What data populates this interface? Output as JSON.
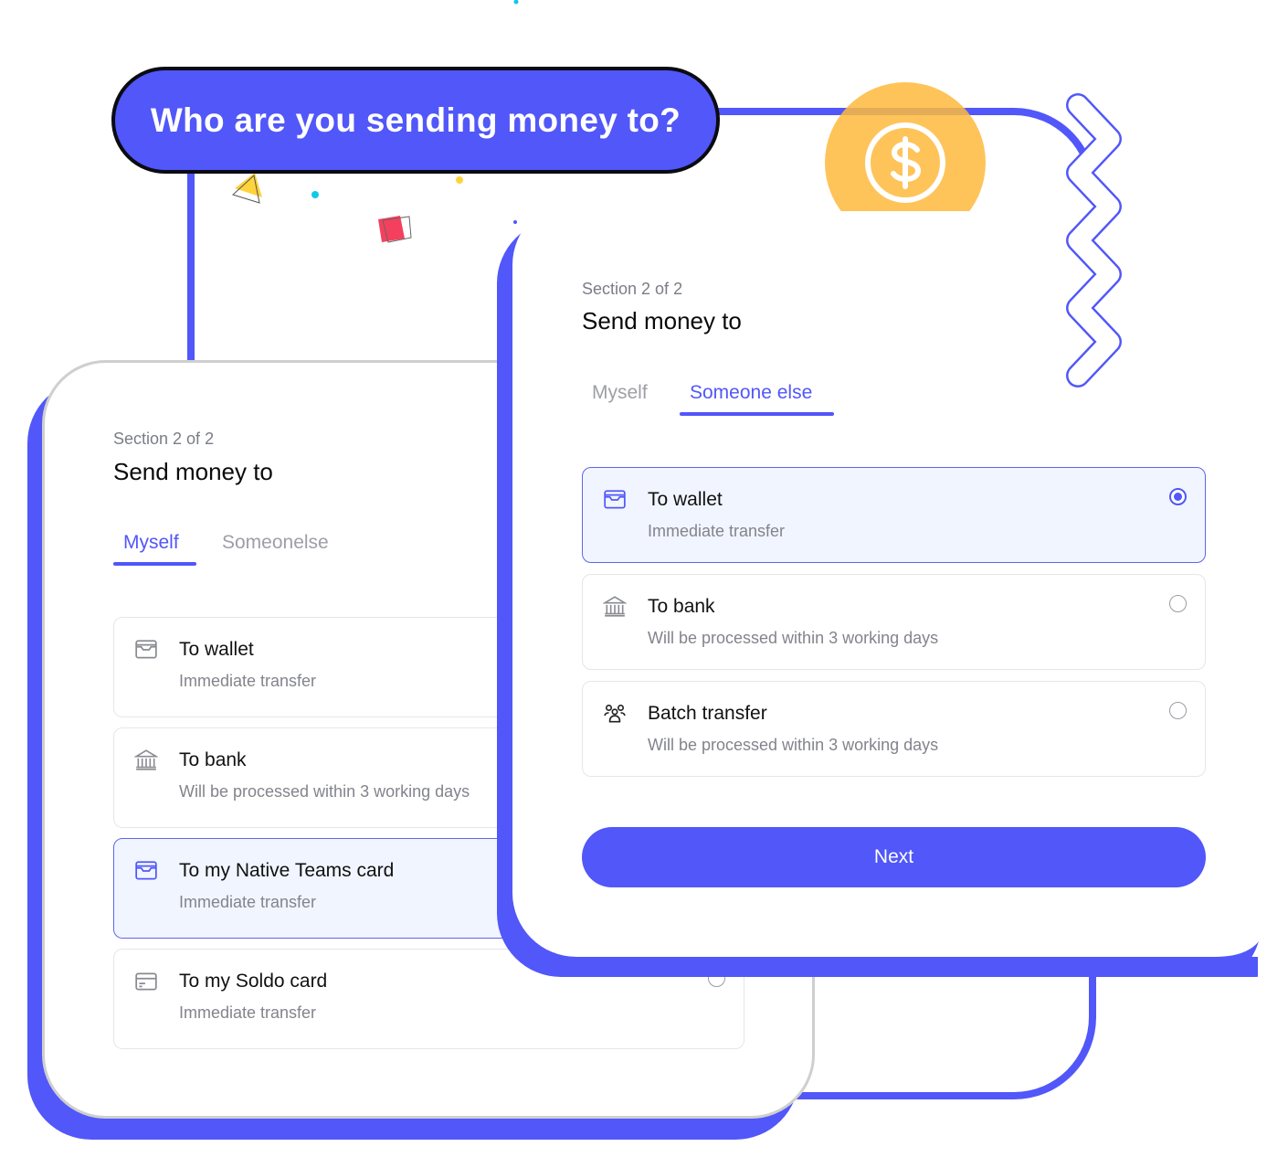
{
  "headline": "Who are you sending money to?",
  "colors": {
    "accent": "#5157f9",
    "coin": "#febb3c",
    "selected_bg": "#f1f5ff",
    "muted_text": "#83848c"
  },
  "decor": {
    "coin_icon": "dollar-coin-icon",
    "zigzag": "zigzag-decoration",
    "confetti": [
      "triangle-yellow",
      "dot-cyan",
      "dot-yellow",
      "square-red",
      "dot-blue",
      "dot-cyan-top"
    ]
  },
  "back_card": {
    "section_label": "Section 2 of 2",
    "title": "Send money to",
    "tabs": [
      {
        "label": "Myself",
        "active": true
      },
      {
        "label": "Someonelse",
        "active": false
      }
    ],
    "options": [
      {
        "icon": "wallet-icon",
        "title": "To wallet",
        "subtitle": "Immediate transfer",
        "selected": false
      },
      {
        "icon": "bank-icon",
        "title": "To bank",
        "subtitle": "Will be processed within 3 working days",
        "selected": false
      },
      {
        "icon": "wallet-icon",
        "title": "To my Native Teams card",
        "subtitle": "Immediate transfer",
        "selected": true
      },
      {
        "icon": "credit-card-icon",
        "title": "To my Soldo card",
        "subtitle": "Immediate transfer",
        "selected": false
      }
    ]
  },
  "front_card": {
    "section_label": "Section 2 of 2",
    "title": "Send money to",
    "tabs": [
      {
        "label": "Myself",
        "active": false
      },
      {
        "label": "Someone else",
        "active": true
      }
    ],
    "options": [
      {
        "icon": "wallet-icon",
        "title": "To wallet",
        "subtitle": "Immediate transfer",
        "selected": true
      },
      {
        "icon": "bank-icon",
        "title": "To bank",
        "subtitle": "Will be processed within 3 working days",
        "selected": false
      },
      {
        "icon": "users-group-icon",
        "title": "Batch transfer",
        "subtitle": "Will be processed within 3 working days",
        "selected": false
      }
    ],
    "next_label": "Next"
  }
}
